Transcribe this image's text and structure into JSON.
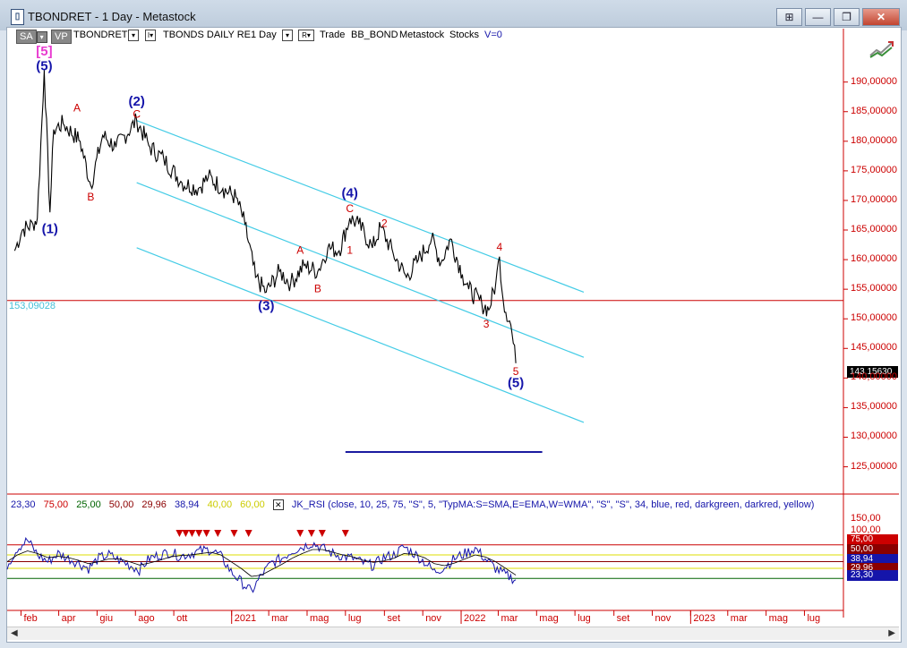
{
  "window": {
    "title": "TBONDRET - 1 Day - Metastock",
    "buttons": [
      "⊞",
      "—",
      "❐",
      "✕"
    ]
  },
  "toolbar": {
    "sa": "SA",
    "vp": "VP",
    "symbol": "TBONDRET",
    "dd1": "▾",
    "dd2": "I▾",
    "series": "TBONDS DAILY RE",
    "interval": "1 Day",
    "dd3": "▾",
    "r": "R▾",
    "trade": "Trade",
    "bb": "BB_BOND",
    "metastock": "Metastock",
    "stocks": "Stocks",
    "v": "V=0"
  },
  "chart_data": [
    {
      "type": "line",
      "title": "TBONDRET",
      "y_ticks": [
        "190,00000",
        "185,00000",
        "180,00000",
        "175,00000",
        "170,00000",
        "165,00000",
        "160,00000",
        "155,00000",
        "150,00000",
        "145,00000",
        "140,00000",
        "135,00000",
        "130,00000",
        "125,00000"
      ],
      "ylim": [
        122,
        197
      ],
      "x_ticks": [
        "feb",
        "apr",
        "giu",
        "ago",
        "ott",
        "2021",
        "mar",
        "mag",
        "lug",
        "set",
        "nov",
        "2022",
        "mar",
        "mag",
        "lug",
        "set",
        "nov",
        "2023",
        "mar",
        "mag",
        "lug"
      ],
      "last_price": "143,15630",
      "horizontal_line": {
        "label": "153,09028",
        "value": 153.09
      },
      "support_line_value": 127.5,
      "series": [
        {
          "x": [
            "2020-01-22",
            "2020-02-03",
            "2020-02-20",
            "2020-02-27",
            "2020-03-09",
            "2020-03-18",
            "2020-03-24",
            "2020-04-08",
            "2020-05-05",
            "2020-05-22",
            "2020-06-10",
            "2020-07-01",
            "2020-08-03",
            "2020-08-24",
            "2020-09-15",
            "2020-10-14",
            "2020-11-09",
            "2020-11-25",
            "2020-12-18",
            "2021-01-08",
            "2021-01-22",
            "2021-02-08",
            "2021-02-25",
            "2021-03-18",
            "2021-04-05",
            "2021-04-26",
            "2021-05-18",
            "2021-06-03",
            "2021-06-21",
            "2021-07-08",
            "2021-07-22",
            "2021-08-13",
            "2021-08-26",
            "2021-09-15",
            "2021-10-06",
            "2021-10-25",
            "2021-11-15",
            "2021-11-30",
            "2021-12-15",
            "2022-01-03",
            "2022-01-13",
            "2022-02-03",
            "2022-02-14",
            "2022-02-25",
            "2022-03-03",
            "2022-03-09",
            "2022-03-21",
            "2022-03-29"
          ],
          "y": [
            161.5,
            165.0,
            166.0,
            167.0,
            192.0,
            168.0,
            182.0,
            183.0,
            180.0,
            172.5,
            181.0,
            179.0,
            183.5,
            179.0,
            177.0,
            173.0,
            172.0,
            174.0,
            172.0,
            170.5,
            166.0,
            157.0,
            154.5,
            158.0,
            156.0,
            159.0,
            158.0,
            162.0,
            161.5,
            167.0,
            166.0,
            162.0,
            165.5,
            161.0,
            157.0,
            160.0,
            163.5,
            159.5,
            163.5,
            157.5,
            155.0,
            152.5,
            151.5,
            156.0,
            160.5,
            153.0,
            149.0,
            142.5
          ]
        }
      ],
      "channels": [
        {
          "x": [
            "2020-08-03",
            "2022-07-15"
          ],
          "y": [
            183.5,
            154.5
          ]
        },
        {
          "x": [
            "2020-08-03",
            "2022-07-15"
          ],
          "y": [
            173.0,
            143.5
          ]
        },
        {
          "x": [
            "2020-08-03",
            "2022-07-15"
          ],
          "y": [
            162.0,
            132.5
          ]
        }
      ],
      "wave_labels": [
        {
          "text": "[5]",
          "x": "2020-03-09",
          "y": 194.5,
          "color": "#e83ad0"
        },
        {
          "text": "(5)",
          "x": "2020-03-09",
          "y": 192.0,
          "color": "#1515aa"
        },
        {
          "text": "(1)",
          "x": "2020-03-18",
          "y": 164.5,
          "color": "#1515aa"
        },
        {
          "text": "A",
          "x": "2020-04-30",
          "y": 185.0,
          "color": "#cc0000"
        },
        {
          "text": "B",
          "x": "2020-05-22",
          "y": 170.0,
          "color": "#cc0000"
        },
        {
          "text": "(2)",
          "x": "2020-08-03",
          "y": 186.0,
          "color": "#1515aa"
        },
        {
          "text": "C",
          "x": "2020-08-03",
          "y": 184.0,
          "color": "#cc0000"
        },
        {
          "text": "(3)",
          "x": "2021-02-25",
          "y": 151.5,
          "color": "#1515aa"
        },
        {
          "text": "A",
          "x": "2021-04-20",
          "y": 161.0,
          "color": "#cc0000"
        },
        {
          "text": "B",
          "x": "2021-05-18",
          "y": 154.5,
          "color": "#cc0000"
        },
        {
          "text": "(4)",
          "x": "2021-07-08",
          "y": 170.5,
          "color": "#1515aa"
        },
        {
          "text": "C",
          "x": "2021-07-08",
          "y": 168.0,
          "color": "#cc0000"
        },
        {
          "text": "1",
          "x": "2021-07-08",
          "y": 161.0,
          "color": "#cc0000"
        },
        {
          "text": "2",
          "x": "2021-09-01",
          "y": 165.5,
          "color": "#cc0000"
        },
        {
          "text": "3",
          "x": "2022-02-10",
          "y": 148.5,
          "color": "#cc0000"
        },
        {
          "text": "4",
          "x": "2022-03-03",
          "y": 161.5,
          "color": "#cc0000"
        },
        {
          "text": "5",
          "x": "2022-03-29",
          "y": 140.5,
          "color": "#cc0000"
        },
        {
          "text": "(5)",
          "x": "2022-03-29",
          "y": 138.5,
          "color": "#1515aa"
        }
      ]
    },
    {
      "type": "line",
      "title": "JK_RSI",
      "header": [
        "23,30",
        "75,00",
        "25,00",
        "50,00",
        "29,96",
        "38,94",
        "40,00",
        "60,00"
      ],
      "header_colors": [
        "#1515aa",
        "#cc0000",
        "#006400",
        "#8b0000",
        "#8b0000",
        "#1515aa",
        "#dddd00",
        "#dddd00"
      ],
      "formula": "JK_RSI (close, 10, 25, 75, \"S\", 5, \"TypMA:S=SMA,E=EMA,W=WMA\", \"S\", \"S\", 34, blue, red, darkgreen, darkred, yellow)",
      "y_ticks": [
        "150,00",
        "100,00"
      ],
      "levels": [
        {
          "value": 75,
          "label": "75,00",
          "color": "#cc0000"
        },
        {
          "value": 60,
          "label": "60,00",
          "color": "#dddd00"
        },
        {
          "value": 50,
          "label": "50,00",
          "color": "#8b0000"
        },
        {
          "value": 40,
          "label": "40,00",
          "color": "#dddd00"
        },
        {
          "value": 25,
          "label": "25,00",
          "color": "#006400"
        }
      ],
      "last_values": [
        {
          "label": "38,94",
          "color": "#1515aa"
        },
        {
          "label": "29,96",
          "color": "#8b0000"
        },
        {
          "label": "23,30",
          "color": "#1515aa"
        }
      ],
      "series": [
        {
          "name": "RSI",
          "values": [
            45,
            70,
            82,
            60,
            50,
            62,
            55,
            48,
            40,
            55,
            60,
            52,
            45,
            38,
            55,
            60,
            64,
            58,
            62,
            66,
            68,
            58,
            35,
            20,
            5,
            30,
            48,
            55,
            66,
            72,
            78,
            70,
            62,
            58,
            55,
            48,
            44,
            56,
            60,
            72,
            62,
            50,
            35,
            42,
            55,
            62,
            70,
            54,
            40,
            30,
            23
          ]
        },
        {
          "name": "MA",
          "values": [
            50,
            60,
            66,
            62,
            56,
            58,
            56,
            52,
            47,
            50,
            54,
            54,
            50,
            45,
            48,
            52,
            57,
            59,
            60,
            62,
            64,
            60,
            50,
            40,
            28,
            30,
            38,
            46,
            55,
            62,
            68,
            68,
            64,
            60,
            57,
            52,
            49,
            51,
            55,
            62,
            61,
            56,
            47,
            44,
            48,
            54,
            60,
            57,
            50,
            40,
            30
          ]
        }
      ],
      "overbought_markers_count": 12
    }
  ]
}
